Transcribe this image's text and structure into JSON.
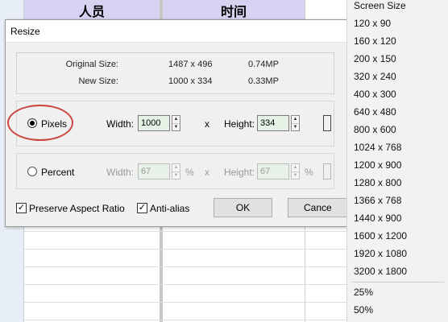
{
  "spreadsheet": {
    "headers": [
      "人员",
      "时间"
    ]
  },
  "dialog": {
    "title": "Resize",
    "original_label": "Original Size:",
    "original_dims": "1487 x 496",
    "original_mp": "0.74MP",
    "new_label": "New Size:",
    "new_dims": "1000 x 334",
    "new_mp": "0.33MP",
    "pixels": {
      "label": "Pixels",
      "selected": true,
      "width_label": "Width:",
      "width_value": "1000",
      "times": "x",
      "height_label": "Height:",
      "height_value": "334"
    },
    "percent": {
      "label": "Percent",
      "selected": false,
      "width_label": "Width:",
      "width_value": "67",
      "pct_symbol": "%",
      "times": "x",
      "height_label": "Height:",
      "height_value": "67",
      "pct_symbol2": "%"
    },
    "preserve_label": "Preserve Aspect Ratio",
    "preserve_checked": true,
    "antialias_label": "Anti-alias",
    "antialias_checked": true,
    "ok_label": "OK",
    "cancel_label": "Cance"
  },
  "menu": {
    "items": [
      "Screen Size",
      "120 x 90",
      "160 x 120",
      "200 x 150",
      "320 x 240",
      "400 x 300",
      "640 x 480",
      "800 x 600",
      "1024 x 768",
      "1200 x 900",
      "1280 x 800",
      "1366 x 768",
      "1440 x 900",
      "1600 x 1200",
      "1920 x 1080",
      "3200 x 1800"
    ],
    "percent_items": [
      "25%",
      "50%"
    ]
  },
  "colors": {
    "header_fill": "#d6d3f2",
    "annotation": "#c9453e",
    "field_fill": "#e6f2e6"
  }
}
